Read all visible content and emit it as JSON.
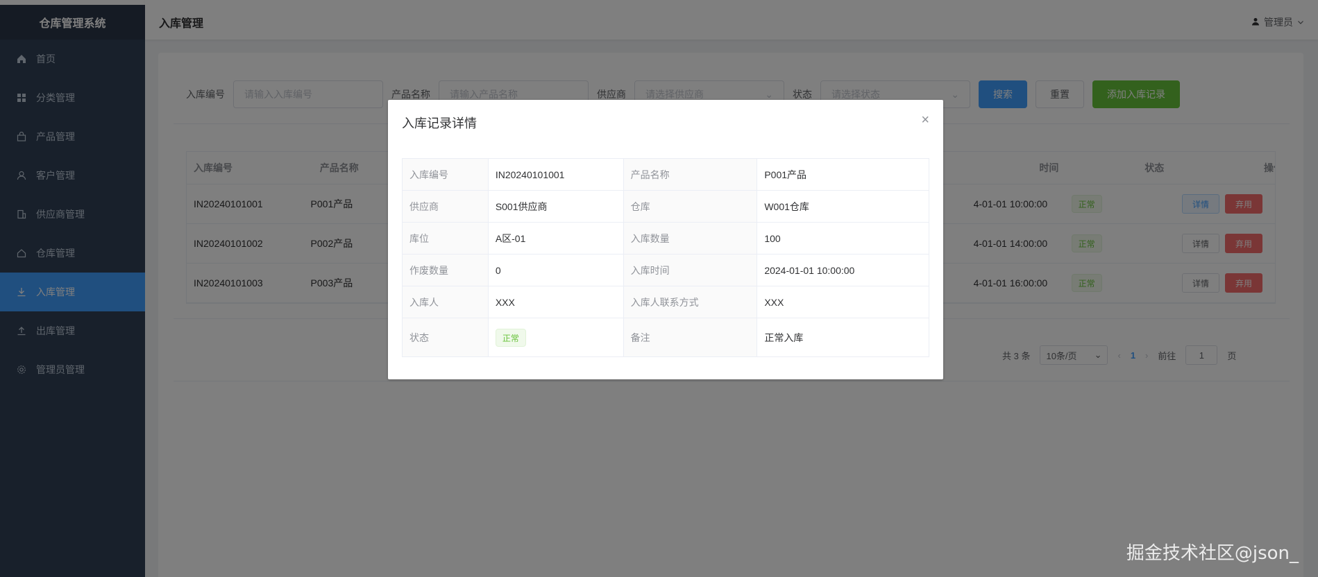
{
  "app": {
    "title": "仓库管理系统"
  },
  "sidebar": {
    "items": [
      {
        "label": "首页",
        "icon": "home-icon"
      },
      {
        "label": "分类管理",
        "icon": "grid-icon"
      },
      {
        "label": "产品管理",
        "icon": "bag-icon"
      },
      {
        "label": "客户管理",
        "icon": "user-icon"
      },
      {
        "label": "供应商管理",
        "icon": "building-icon"
      },
      {
        "label": "仓库管理",
        "icon": "house-icon"
      },
      {
        "label": "入库管理",
        "icon": "download-icon",
        "active": true
      },
      {
        "label": "出库管理",
        "icon": "upload-icon"
      },
      {
        "label": "管理员管理",
        "icon": "gear-icon"
      }
    ]
  },
  "header": {
    "title": "入库管理",
    "user": "管理员"
  },
  "filters": {
    "inbound_no_label": "入库编号",
    "inbound_no_placeholder": "请输入入库编号",
    "product_label": "产品名称",
    "product_placeholder": "请输入产品名称",
    "supplier_label": "供应商",
    "supplier_placeholder": "请选择供应商",
    "status_label": "状态",
    "status_placeholder": "请选择状态",
    "search_button": "搜索",
    "reset_button": "重置",
    "add_button": "添加入库记录"
  },
  "table": {
    "headers": [
      "入库编号",
      "产品名称",
      "",
      "时间",
      "状态",
      "操作"
    ],
    "rows": [
      {
        "no": "IN20240101001",
        "product": "P001产品",
        "time": "4-01-01 10:00:00",
        "status": "正常"
      },
      {
        "no": "IN20240101002",
        "product": "P002产品",
        "time": "4-01-01 14:00:00",
        "status": "正常"
      },
      {
        "no": "IN20240101003",
        "product": "P003产品",
        "time": "4-01-01 16:00:00",
        "status": "正常"
      }
    ],
    "detail_button": "详情",
    "disable_button": "弃用"
  },
  "pagination": {
    "total": "共 3 条",
    "page_size": "10条/页",
    "current": "1",
    "goto_label": "前往",
    "goto_value": "1",
    "page_suffix": "页"
  },
  "dialog": {
    "title": "入库记录详情",
    "rows": [
      {
        "l1": "入库编号",
        "v1": "IN20240101001",
        "l2": "产品名称",
        "v2": "P001产品"
      },
      {
        "l1": "供应商",
        "v1": "S001供应商",
        "l2": "仓库",
        "v2": "W001仓库"
      },
      {
        "l1": "库位",
        "v1": "A区-01",
        "l2": "入库数量",
        "v2": "100"
      },
      {
        "l1": "作废数量",
        "v1": "0",
        "l2": "入库时间",
        "v2": "2024-01-01 10:00:00"
      },
      {
        "l1": "入库人",
        "v1": "XXX",
        "l2": "入库人联系方式",
        "v2": "XXX"
      }
    ],
    "status_label": "状态",
    "status_value": "正常",
    "remark_label": "备注",
    "remark_value": "正常入库"
  },
  "watermark": "掘金技术社区@json_",
  "colors": {
    "primary": "#409eff",
    "success": "#67c23a",
    "danger": "#f56c6c",
    "sidebar": "#304156"
  }
}
